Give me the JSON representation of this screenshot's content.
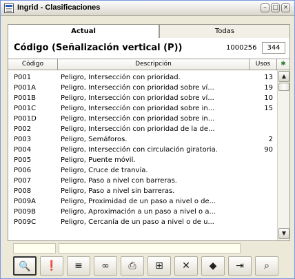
{
  "window": {
    "title": "Ingrid - Clasificaciones",
    "controls": [
      "minimize",
      "maximize",
      "close"
    ]
  },
  "tabs": [
    {
      "label": "Actual",
      "active": true
    },
    {
      "label": "Todas",
      "active": false
    }
  ],
  "header": {
    "title": "Código (Señalización vertical (P))",
    "number": "1000256",
    "count": "344"
  },
  "table": {
    "columns": [
      "Código",
      "Descripción",
      "Usos"
    ],
    "rows": [
      {
        "code": "P001",
        "desc": "Peligro, Intersección con prioridad.",
        "uses": "13"
      },
      {
        "code": "P001A",
        "desc": "Peligro, Intersección con prioridad sobre ví...",
        "uses": "19"
      },
      {
        "code": "P001B",
        "desc": "Peligro, Intersección con prioridad sobre ví...",
        "uses": "10"
      },
      {
        "code": "P001C",
        "desc": "Peligro, Intersección con prioridad sobre in...",
        "uses": "15"
      },
      {
        "code": "P001D",
        "desc": "Peligro, Intersección con prioridad sobre in...",
        "uses": ""
      },
      {
        "code": "P002",
        "desc": "Peligro, Intersección con prioridad de la de...",
        "uses": ""
      },
      {
        "code": "P003",
        "desc": "Peligro, Semáforos.",
        "uses": "2"
      },
      {
        "code": "P004",
        "desc": "Peligro, Intersección con circulación giratoria.",
        "uses": "90"
      },
      {
        "code": "P005",
        "desc": "Peligro, Puente móvil.",
        "uses": ""
      },
      {
        "code": "P006",
        "desc": "Peligro, Cruce de tranvía.",
        "uses": ""
      },
      {
        "code": "P007",
        "desc": "Peligro, Paso a nivel con barreras.",
        "uses": ""
      },
      {
        "code": "P008",
        "desc": "Peligro, Paso a nivel sin barreras.",
        "uses": ""
      },
      {
        "code": "P009A",
        "desc": "Peligro, Proximidad de un paso a nivel o de...",
        "uses": ""
      },
      {
        "code": "P009B",
        "desc": "Peligro, Aproximación a un paso a nivel o a...",
        "uses": ""
      },
      {
        "code": "P009C",
        "desc": "Peligro, Cercanía de un paso a nivel o de u...",
        "uses": ""
      }
    ]
  },
  "toolbar": {
    "icons": [
      "binoculars-icon",
      "note-icon",
      "list-icon",
      "link-icon",
      "print-icon",
      "network-icon",
      "delete-icon",
      "book-icon",
      "export-icon",
      "search-folder-icon"
    ]
  }
}
